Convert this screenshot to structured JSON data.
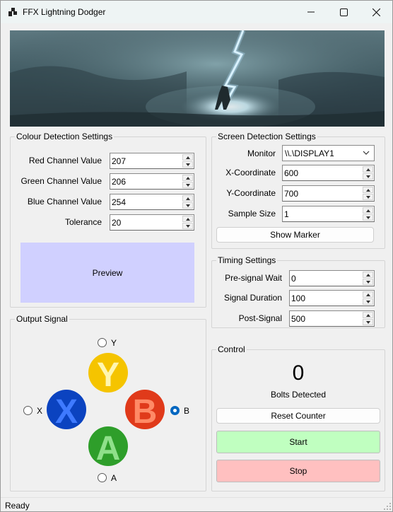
{
  "window": {
    "title": "FFX Lightning Dodger",
    "minimize_icon": "minimize-icon",
    "maximize_icon": "maximize-icon",
    "close_icon": "close-icon"
  },
  "colour_settings": {
    "title": "Colour Detection Settings",
    "red_label": "Red Channel Value",
    "red_value": "207",
    "green_label": "Green Channel Value",
    "green_value": "206",
    "blue_label": "Blue Channel Value",
    "blue_value": "254",
    "tolerance_label": "Tolerance",
    "tolerance_value": "20",
    "preview_label": "Preview",
    "preview_color": "#d0d0ff"
  },
  "screen_settings": {
    "title": "Screen Detection Settings",
    "monitor_label": "Monitor",
    "monitor_value": "\\\\.\\DISPLAY1",
    "x_label": "X-Coordinate",
    "x_value": "600",
    "y_label": "Y-Coordinate",
    "y_value": "700",
    "sample_label": "Sample Size",
    "sample_value": "1",
    "show_marker": "Show Marker"
  },
  "timing_settings": {
    "title": "Timing Settings",
    "pre_label": "Pre-signal Wait",
    "pre_value": "0",
    "duration_label": "Signal Duration",
    "duration_value": "100",
    "post_label": "Post-Signal",
    "post_value": "500"
  },
  "output_signal": {
    "title": "Output Signal",
    "y_label": "Y",
    "x_label": "X",
    "b_label": "B",
    "a_label": "A",
    "selected": "B",
    "colors": {
      "y": "#f5c400",
      "x": "#0b43c0",
      "b": "#e03a1a",
      "a": "#2e9e2a"
    }
  },
  "control": {
    "title": "Control",
    "count": "0",
    "bolts_label": "Bolts Detected",
    "reset": "Reset Counter",
    "start": "Start",
    "stop": "Stop"
  },
  "status": {
    "text": "Ready"
  }
}
